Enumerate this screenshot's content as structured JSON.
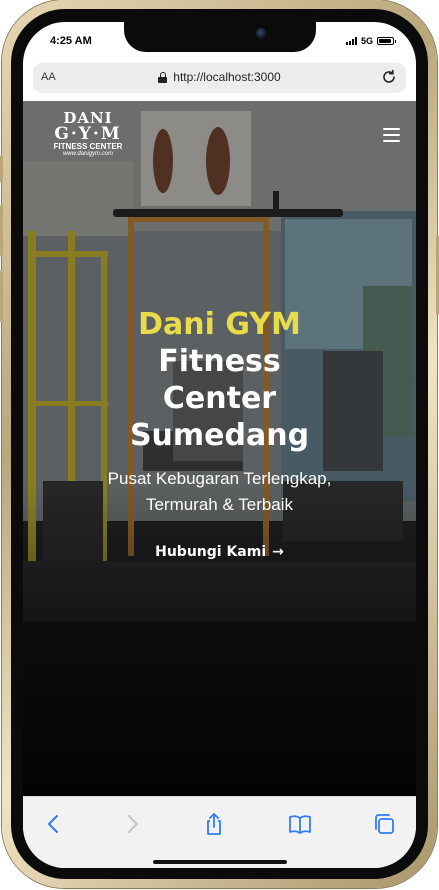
{
  "status_bar": {
    "time": "4:25 AM",
    "network": "5G",
    "battery_level": 0.9
  },
  "browser": {
    "text_size_label": "AA",
    "url": "http://localhost:3000",
    "icons": [
      "lock-icon",
      "reload-icon"
    ]
  },
  "site": {
    "logo": {
      "line1": "DANI",
      "line2": "G·Y·M",
      "line3": "FITNESS CENTER",
      "line4": "www.danigym.com"
    },
    "hero": {
      "title_highlight": "Dani GYM",
      "title_rest": "Fitness Center Sumedang",
      "subtitle": "Pusat Kebugaran Terlengkap, Termurah & Terbaik",
      "cta_label": "Hubungi Kami",
      "cta_arrow": "→"
    }
  },
  "toolbar": {
    "icons": [
      "back-icon",
      "forward-icon",
      "share-icon",
      "bookmarks-icon",
      "tabs-icon"
    ]
  },
  "colors": {
    "accent_yellow": "#e9dc4a",
    "frame_gold": "#c9b88e",
    "ios_blue": "#2f7cf6"
  }
}
